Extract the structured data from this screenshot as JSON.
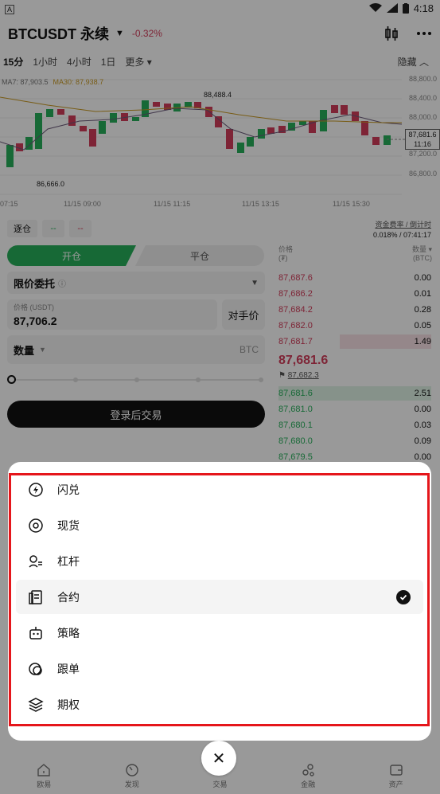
{
  "status": {
    "time": "4:18",
    "app_badge": "A"
  },
  "header": {
    "pair": "BTCUSDT 永续",
    "change": "-0.32%"
  },
  "timeframes": [
    "15分",
    "1小时",
    "4小时",
    "1日",
    "更多"
  ],
  "timebar_hide": "隐藏",
  "chart": {
    "ma7_label": "MA7: 87,903.5",
    "ma30_label": "MA30: 87,938.7",
    "high_marker": "88,488.4",
    "low_marker": "86,666.0",
    "price_ticks": [
      "88,800.0",
      "88,400.0",
      "88,000.0",
      "87,600.0",
      "87,200.0",
      "86,800.0"
    ],
    "current_price_tag": "87,681.6",
    "countdown_tag": "11:16",
    "time_ticks": [
      "07:15",
      "11/15 09:00",
      "11/15 11:15",
      "11/15 13:15",
      "11/15 15:30"
    ]
  },
  "controls": {
    "margin_mode": "逐仓",
    "leverage_long": "--",
    "leverage_short": "--",
    "funding_label": "资金费率 / 倒计时",
    "funding_value": "0.018% / 07:41:17",
    "open_tab": "开仓",
    "close_tab": "平仓",
    "order_type": "限价委托",
    "price_label": "价格 (USDT)",
    "price_value": "87,706.2",
    "counter_price": "对手价",
    "qty_label": "数量",
    "qty_unit": "BTC",
    "login_button": "登录后交易"
  },
  "orderbook": {
    "price_header": "价格",
    "price_unit": "(₮)",
    "qty_header": "数量",
    "qty_unit": "(BTC)",
    "asks": [
      {
        "price": "87,687.6",
        "qty": "0.00"
      },
      {
        "price": "87,686.2",
        "qty": "0.01"
      },
      {
        "price": "87,684.2",
        "qty": "0.28"
      },
      {
        "price": "87,682.0",
        "qty": "0.05"
      },
      {
        "price": "87,681.7",
        "qty": "1.49"
      }
    ],
    "last_price": "87,681.6",
    "mark_price": "87,682.3",
    "bids": [
      {
        "price": "87,681.6",
        "qty": "2.51"
      },
      {
        "price": "87,681.0",
        "qty": "0.00"
      },
      {
        "price": "87,680.1",
        "qty": "0.03"
      },
      {
        "price": "87,680.0",
        "qty": "0.09"
      },
      {
        "price": "87,679.5",
        "qty": "0.00"
      }
    ]
  },
  "menu": [
    {
      "label": "闪兑",
      "icon": "flash-swap-icon",
      "selected": false
    },
    {
      "label": "现货",
      "icon": "spot-icon",
      "selected": false
    },
    {
      "label": "杠杆",
      "icon": "margin-icon",
      "selected": false
    },
    {
      "label": "合约",
      "icon": "contract-icon",
      "selected": true
    },
    {
      "label": "策略",
      "icon": "bot-icon",
      "selected": false
    },
    {
      "label": "跟单",
      "icon": "copy-trade-icon",
      "selected": false
    },
    {
      "label": "期权",
      "icon": "options-icon",
      "selected": false
    }
  ],
  "nav": [
    {
      "label": "欧易",
      "icon": "home-icon"
    },
    {
      "label": "发现",
      "icon": "discover-icon"
    },
    {
      "label": "交易",
      "icon": "close-icon"
    },
    {
      "label": "金融",
      "icon": "finance-icon"
    },
    {
      "label": "资产",
      "icon": "assets-icon"
    }
  ],
  "colors": {
    "up": "#27b05b",
    "down": "#d23d5a",
    "highlight": "#e5161b",
    "ma30": "#c99a24"
  }
}
